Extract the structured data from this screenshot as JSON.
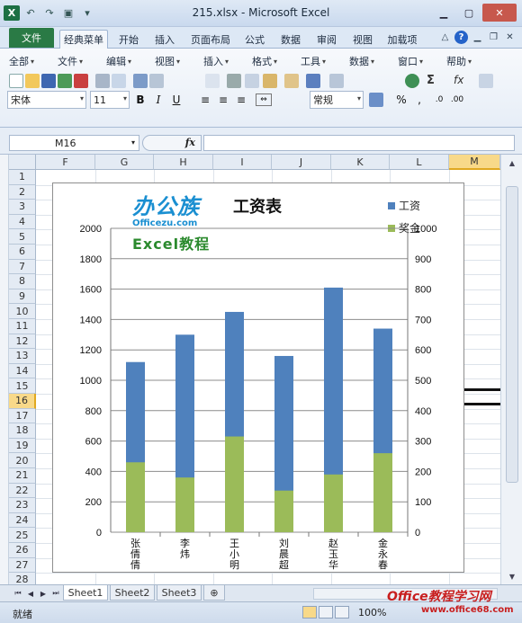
{
  "window": {
    "title": "215.xlsx - Microsoft Excel"
  },
  "ribbon_tabs": [
    {
      "label": "文件"
    },
    {
      "label": "经典菜单"
    },
    {
      "label": "开始"
    },
    {
      "label": "插入"
    },
    {
      "label": "页面布局"
    },
    {
      "label": "公式"
    },
    {
      "label": "数据"
    },
    {
      "label": "审阅"
    },
    {
      "label": "视图"
    },
    {
      "label": "加载项"
    }
  ],
  "classic_menu": [
    {
      "label": "全部"
    },
    {
      "label": "文件"
    },
    {
      "label": "编辑"
    },
    {
      "label": "视图"
    },
    {
      "label": "插入"
    },
    {
      "label": "格式"
    },
    {
      "label": "工具"
    },
    {
      "label": "数据"
    },
    {
      "label": "窗口"
    },
    {
      "label": "帮助"
    }
  ],
  "format": {
    "font": "宋体",
    "size": "11",
    "number_format": "常规",
    "bold": "B",
    "italic": "I",
    "underline": "U",
    "percent": "%",
    "comma": ","
  },
  "formula_bar": {
    "name_box": "M16",
    "fx": "fx",
    "value": ""
  },
  "columns": [
    "F",
    "G",
    "H",
    "I",
    "J",
    "K",
    "L",
    "M"
  ],
  "selected_column": "M",
  "rows": [
    "1",
    "2",
    "3",
    "4",
    "5",
    "6",
    "7",
    "8",
    "9",
    "10",
    "11",
    "12",
    "13",
    "14",
    "15",
    "16",
    "17",
    "18",
    "19",
    "20",
    "21",
    "22",
    "23",
    "24",
    "25",
    "26",
    "27",
    "28"
  ],
  "selected_row": "16",
  "chart_data": {
    "type": "bar",
    "stacked": true,
    "title": "工资表",
    "categories": [
      "张倩倩",
      "李炜",
      "王小明",
      "刘晨超",
      "赵玉华",
      "金永春"
    ],
    "series": [
      {
        "name": "工资",
        "axis": "left",
        "values": [
          1120,
          1300,
          1450,
          1160,
          1610,
          1340
        ],
        "color": "#4f81bd"
      },
      {
        "name": "奖金",
        "axis": "right",
        "values": [
          230,
          180,
          315,
          137,
          190,
          260
        ],
        "color": "#9bbb59"
      }
    ],
    "y_left": {
      "min": 0,
      "max": 2000,
      "ticks": [
        "0",
        "200",
        "400",
        "600",
        "800",
        "1000",
        "1200",
        "1400",
        "1600",
        "1800",
        "2000"
      ]
    },
    "y_right": {
      "min": 0,
      "max": 1000,
      "ticks": [
        "0",
        "100",
        "200",
        "300",
        "400",
        "500",
        "600",
        "700",
        "800",
        "900",
        "1000"
      ]
    },
    "grid": true,
    "legend_placement": "top-right"
  },
  "logo": {
    "big": "办公族",
    "small": "Officezu.com",
    "excel": "Excel教程"
  },
  "sheets": [
    {
      "label": "Sheet1"
    },
    {
      "label": "Sheet2"
    },
    {
      "label": "Sheet3"
    }
  ],
  "active_sheet": "Sheet1",
  "status": {
    "ready": "就绪",
    "zoom": "100%"
  },
  "watermark": {
    "main": "Office教程学习网",
    "url": "www.office68.com"
  }
}
